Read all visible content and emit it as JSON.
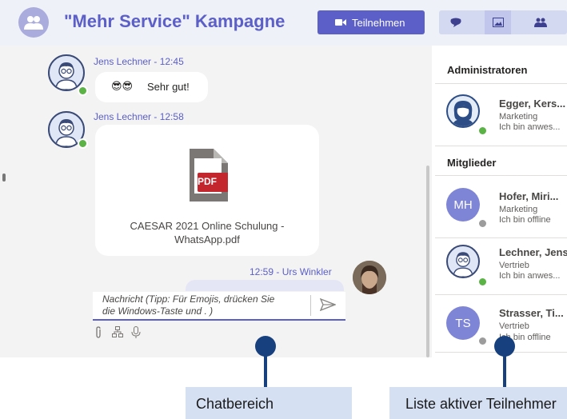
{
  "header": {
    "title": "\"Mehr Service\" Kampagne",
    "join_label": "Teilnehmen"
  },
  "chat": {
    "messages": [
      {
        "author_time": "Jens Lechner - 12:45",
        "text": "Sehr gut!",
        "emoji": "😎😎"
      },
      {
        "author_time": "Jens Lechner - 12:58",
        "file_name_line1": "CAESAR 2021 Online Schulung -",
        "file_name_line2": "WhatsApp.pdf",
        "file_badge": "PDF"
      }
    ],
    "own_message": {
      "author_time": "12:59 - Urs Winkler"
    },
    "composer": {
      "placeholder_line1": "Nachricht   (Tipp: Für Emojis, drücken Sie",
      "placeholder_line2": "die Windows-Taste und . )"
    }
  },
  "members": {
    "admins_heading": "Administratoren",
    "members_heading": "Mitglieder",
    "admins": [
      {
        "name": "Egger, Kers...",
        "role": "Marketing",
        "status": "Ich bin anwes...",
        "online": true
      }
    ],
    "list": [
      {
        "initials": "MH",
        "name": "Hofer, Miri...",
        "role": "Marketing",
        "status": "Ich bin offline",
        "online": false
      },
      {
        "initials": "",
        "name": "Lechner, Jens",
        "role": "Vertrieb",
        "status": "Ich bin anwes...",
        "online": true
      },
      {
        "initials": "TS",
        "name": "Strasser, Ti...",
        "role": "Vertrieb",
        "status": "Ich bin offline",
        "online": false
      }
    ]
  },
  "callouts": {
    "chat_label": "Chatbereich",
    "participants_label": "Liste aktiver Teilnehmer"
  },
  "colors": {
    "brand": "#5b5fc7",
    "online": "#5bb346",
    "offline": "#9c9c9c",
    "callout": "#17407e",
    "callout_box": "#d5e0f3",
    "pdf_badge": "#c4262e"
  },
  "icons": [
    "group-icon",
    "video-camera-icon",
    "chat-bubble-icon",
    "image-icon",
    "people-icon",
    "pdf-file-icon",
    "send-icon",
    "attach-icon",
    "org-chart-icon",
    "microphone-icon"
  ]
}
